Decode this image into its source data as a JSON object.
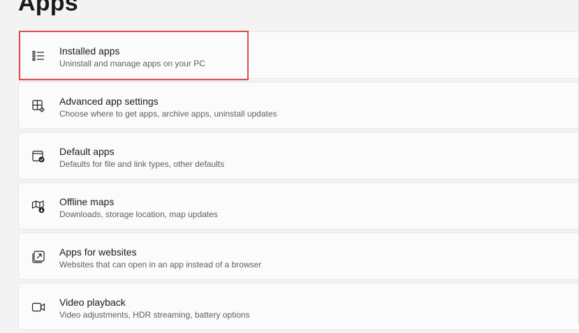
{
  "page": {
    "title": "Apps",
    "highlight_color": "#e24a4a"
  },
  "items": [
    {
      "title": "Installed apps",
      "subtitle": "Uninstall and manage apps on your PC",
      "icon": "installed-apps-list-icon",
      "highlighted": true
    },
    {
      "title": "Advanced app settings",
      "subtitle": "Choose where to get apps, archive apps, uninstall updates",
      "icon": "advanced-app-settings-icon"
    },
    {
      "title": "Default apps",
      "subtitle": "Defaults for file and link types, other defaults",
      "icon": "default-apps-icon"
    },
    {
      "title": "Offline maps",
      "subtitle": "Downloads, storage location, map updates",
      "icon": "offline-maps-icon"
    },
    {
      "title": "Apps for websites",
      "subtitle": "Websites that can open in an app instead of a browser",
      "icon": "apps-for-websites-icon"
    },
    {
      "title": "Video playback",
      "subtitle": "Video adjustments, HDR streaming, battery options",
      "icon": "video-playback-icon"
    }
  ]
}
